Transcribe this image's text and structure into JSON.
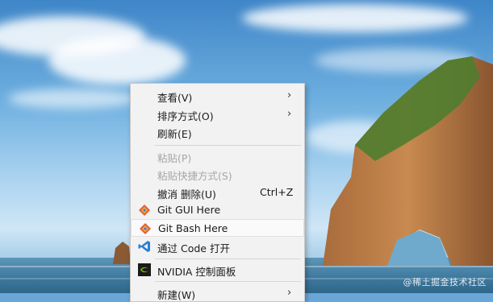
{
  "menu": {
    "items": [
      {
        "label": "查看(V)",
        "submenu": true
      },
      {
        "label": "排序方式(O)",
        "submenu": true
      },
      {
        "label": "刷新(E)"
      },
      {
        "label": "粘贴(P)",
        "disabled": true
      },
      {
        "label": "粘贴快捷方式(S)",
        "disabled": true
      },
      {
        "label": "撤消 删除(U)",
        "shortcut": "Ctrl+Z"
      },
      {
        "label": "Git GUI Here",
        "icon": "git-gui-icon"
      },
      {
        "label": "Git Bash Here",
        "icon": "git-bash-icon"
      },
      {
        "label": "通过 Code 打开",
        "icon": "vscode-icon"
      },
      {
        "label": "NVIDIA 控制面板",
        "icon": "nvidia-icon"
      },
      {
        "label": "新建(W)",
        "submenu": true
      }
    ],
    "submenu_arrow": "›"
  },
  "watermark": "@稀土掘金技术社区",
  "colors": {
    "menu_bg": "#f2f2f2",
    "vscode_blue": "#2a7fd4",
    "nvidia_green": "#76b900"
  }
}
